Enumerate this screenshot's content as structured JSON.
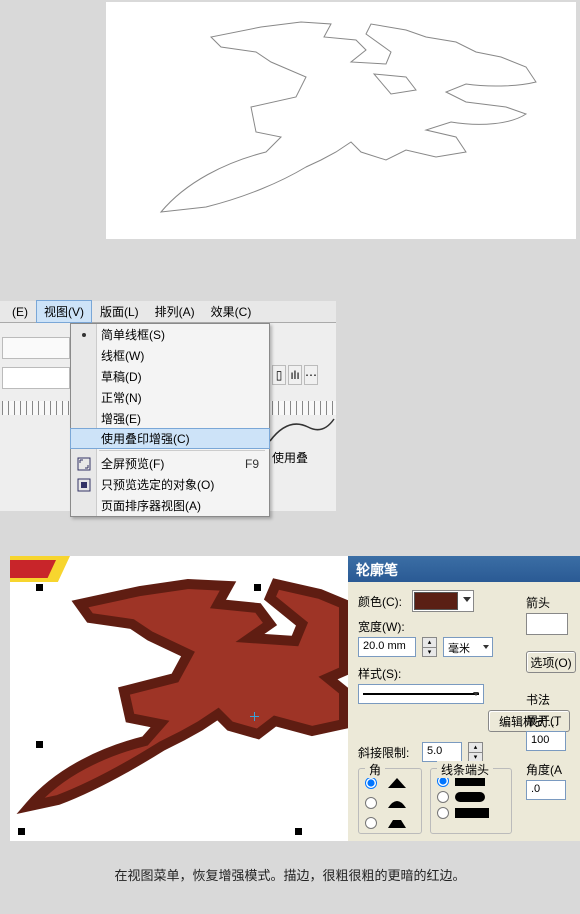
{
  "menubar": {
    "items": [
      {
        "label": "(E)"
      },
      {
        "label": "视图(V)"
      },
      {
        "label": "版面(L)"
      },
      {
        "label": "排列(A)"
      },
      {
        "label": "效果(C)"
      }
    ]
  },
  "dropdown": {
    "items": [
      {
        "label": "简单线框(S)"
      },
      {
        "label": "线框(W)"
      },
      {
        "label": "草稿(D)"
      },
      {
        "label": "正常(N)"
      },
      {
        "label": "增强(E)"
      },
      {
        "label": "使用叠印增强(C)"
      },
      {
        "label": "全屏预览(F)",
        "shortcut": "F9"
      },
      {
        "label": "只预览选定的对象(O)"
      },
      {
        "label": "页面排序器视图(A)"
      }
    ]
  },
  "bg_label": "使用叠",
  "dialog": {
    "title": "轮廓笔",
    "color_label": "颜色(C):",
    "color_value": "#5a1f14",
    "width_label": "宽度(W):",
    "width_value": "20.0 mm",
    "width_unit": "毫米",
    "style_label": "样式(S):",
    "edit_style_btn": "编辑样式…",
    "miter_label": "斜接限制:",
    "miter_value": "5.0",
    "corner_label": "角",
    "linecap_label": "线条端头",
    "arrow_label": "箭头",
    "options_btn": "选项(O)",
    "callig_label": "书法",
    "stretch_label": "展开(T",
    "stretch_value": "100",
    "angle_label": "角度(A",
    "angle_value": ".0"
  },
  "caption": "在视图菜单，恢复增强模式。描边，很粗很粗的更暗的红边。"
}
